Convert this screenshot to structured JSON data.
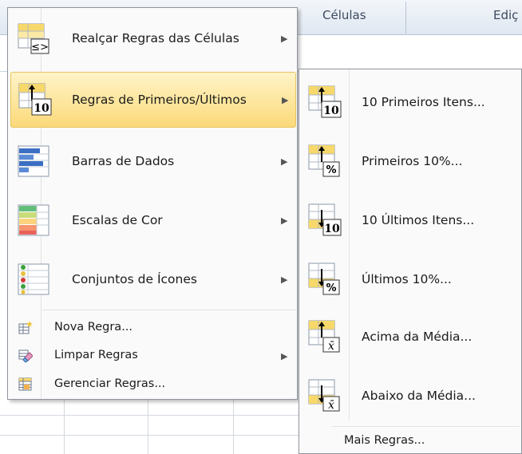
{
  "ribbon": {
    "group_cells": "Células",
    "group_edit": "Ediç"
  },
  "main_menu": {
    "items": [
      {
        "label": "Realçar Regras das Células",
        "icon": "highlight-rules-icon",
        "has_submenu": true
      },
      {
        "label": "Regras de Primeiros/Últimos",
        "icon": "top-bottom-rules-icon",
        "has_submenu": true,
        "highlighted": true
      },
      {
        "label": "Barras de Dados",
        "icon": "data-bars-icon",
        "has_submenu": true
      },
      {
        "label": "Escalas de Cor",
        "icon": "color-scales-icon",
        "has_submenu": true
      },
      {
        "label": "Conjuntos de Ícones",
        "icon": "icon-sets-icon",
        "has_submenu": true
      }
    ],
    "commands": [
      {
        "label": "Nova Regra...",
        "icon": "new-rule-icon",
        "has_submenu": false
      },
      {
        "label": "Limpar Regras",
        "icon": "clear-rules-icon",
        "has_submenu": true
      },
      {
        "label": "Gerenciar Regras...",
        "icon": "manage-rules-icon",
        "has_submenu": false
      }
    ]
  },
  "submenu": {
    "items": [
      {
        "label": "10 Primeiros Itens...",
        "icon": "top-10-items-icon"
      },
      {
        "label": "Primeiros 10%...",
        "icon": "top-10-percent-icon"
      },
      {
        "label": "10 Últimos Itens...",
        "icon": "bottom-10-items-icon"
      },
      {
        "label": "Últimos 10%...",
        "icon": "bottom-10-percent-icon"
      },
      {
        "label": "Acima da Média...",
        "icon": "above-average-icon"
      },
      {
        "label": "Abaixo da Média...",
        "icon": "below-average-icon"
      }
    ],
    "more": "Mais Regras..."
  },
  "colors": {
    "highlight_top": "#fff3c8",
    "highlight_bottom": "#fbd97a",
    "highlight_border": "#e8c45f",
    "menu_bg": "#fafafa",
    "menu_border": "#8f949c"
  }
}
